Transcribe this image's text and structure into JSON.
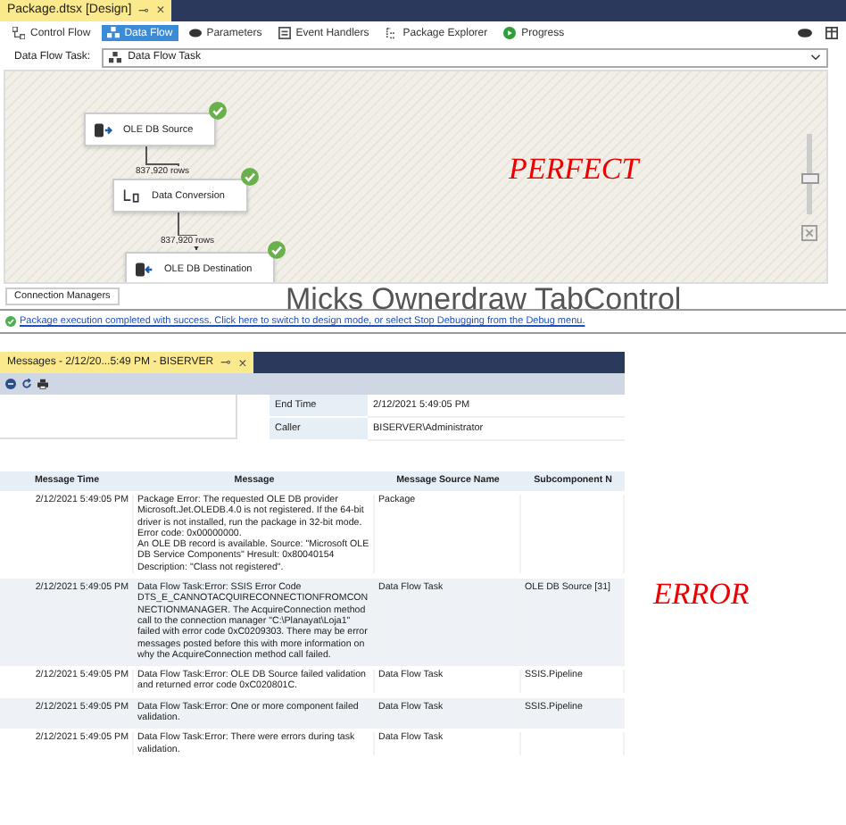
{
  "designer": {
    "document_tab": {
      "title": "Package.dtsx [Design]",
      "pin": "⊸",
      "close": "×"
    },
    "tabs": [
      {
        "label": "Control Flow",
        "selected": false,
        "kind": "flow"
      },
      {
        "label": "Data Flow",
        "selected": true,
        "kind": "dataflow"
      },
      {
        "label": "Parameters",
        "selected": false,
        "kind": "params"
      },
      {
        "label": "Event Handlers",
        "selected": false,
        "kind": "events"
      },
      {
        "label": "Package Explorer",
        "selected": false,
        "kind": "explorer"
      },
      {
        "label": "Progress",
        "selected": false,
        "kind": "progress"
      }
    ],
    "task_label": "Data Flow Task:",
    "task_value": "Data Flow Task",
    "nodes": [
      {
        "name": "OLE DB Source",
        "kind": "source",
        "succeeded": true
      },
      {
        "name": "Data Conversion",
        "kind": "conversion",
        "succeeded": true
      },
      {
        "name": "OLE DB Destination",
        "kind": "destination",
        "succeeded": true
      }
    ],
    "row_counts": [
      "837,920 rows",
      "837,920 rows"
    ],
    "zoom_slider": {
      "level": 0.45
    },
    "annotation": "PERFECT",
    "connection_managers_tab": "Connection Managers",
    "overlay_text": "Micks Ownerdraw TabControl",
    "status_message": "Package execution completed with success. Click here to switch to design mode, or select Stop Debugging from the Debug menu."
  },
  "messages": {
    "document_tab": {
      "title": "Messages - 2/12/20...5:49 PM - BISERVER",
      "pin": "⊸",
      "close": "×"
    },
    "details": [
      {
        "label": "End Time",
        "value": "2/12/2021 5:49:05 PM"
      },
      {
        "label": "Caller",
        "value": "BISERVER\\Administrator"
      }
    ],
    "columns": [
      "Message Time",
      "Message",
      "Message Source Name",
      "Subcomponent N"
    ],
    "rows": [
      {
        "time": "2/12/2021 5:49:05 PM",
        "message": "Package Error: The requested OLE DB provider Microsoft.Jet.OLEDB.4.0 is not registered. If the 64-bit driver is not installed, run the package in 32-bit mode. Error code: 0x00000000.\nAn OLE DB record is available.  Source: \"Microsoft OLE DB Service Components\"  Hresult: 0x80040154  Description: \"Class not registered\".",
        "source": "Package",
        "subcomponent": ""
      },
      {
        "time": "2/12/2021 5:49:05 PM",
        "message": "Data Flow Task:Error: SSIS Error Code DTS_E_CANNOTACQUIRECONNECTIONFROMCONNECTIONMANAGER.  The AcquireConnection method call to the connection manager \"C:\\Planayat\\Loja1\" failed with error code 0xC0209303.  There may be error messages posted before this with more information on why the AcquireConnection method call failed.",
        "source": "Data Flow Task",
        "subcomponent": "OLE DB Source [31]"
      },
      {
        "time": "2/12/2021 5:49:05 PM",
        "message": "Data Flow Task:Error: OLE DB Source failed validation and returned error code 0xC020801C.",
        "source": "Data Flow Task",
        "subcomponent": "SSIS.Pipeline"
      },
      {
        "time": "2/12/2021 5:49:05 PM",
        "message": "Data Flow Task:Error: One or more component failed validation.",
        "source": "Data Flow Task",
        "subcomponent": "SSIS.Pipeline"
      },
      {
        "time": "2/12/2021 5:49:05 PM",
        "message": "Data Flow Task:Error: There were errors during task validation.",
        "source": "Data Flow Task",
        "subcomponent": ""
      }
    ],
    "annotation": "ERROR"
  }
}
